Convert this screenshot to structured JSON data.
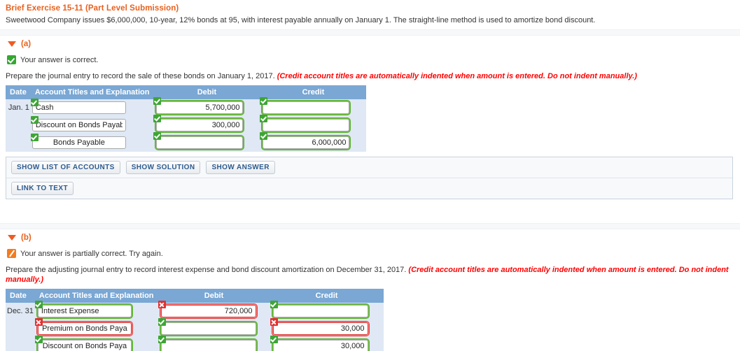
{
  "exercise": {
    "title": "Brief Exercise 15-11 (Part Level Submission)",
    "description": "Sweetwood Company issues $6,000,000, 10-year, 12% bonds at 95, with interest payable annually on January 1. The straight-line method is used to amortize bond discount."
  },
  "columns": {
    "date": "Date",
    "account": "Account Titles and Explanation",
    "debit": "Debit",
    "credit": "Credit"
  },
  "icons": {
    "collapse": "triangle-down-icon",
    "correct": "green-check-icon",
    "partial": "orange-slash-icon",
    "field_ok": "green-check-badge",
    "field_err": "red-x-badge"
  },
  "part_a": {
    "label": "(a)",
    "status": "Your answer is correct.",
    "status_type": "correct",
    "prompt": "Prepare the journal entry to record the sale of these bonds on January 1, 2017.",
    "hint": "(Credit account titles are automatically indented when amount is entered. Do not indent manually.)",
    "rows": [
      {
        "date": "Jan. 1",
        "account": "Cash",
        "account_state": "ok",
        "account_indent": false,
        "debit": "5,700,000",
        "debit_state": "ok",
        "credit": "",
        "credit_state": "ok"
      },
      {
        "date": "",
        "account": "Discount on Bonds Payable",
        "account_state": "ok",
        "account_indent": false,
        "debit": "300,000",
        "debit_state": "ok",
        "credit": "",
        "credit_state": "ok"
      },
      {
        "date": "",
        "account": "Bonds Payable",
        "account_state": "ok",
        "account_indent": true,
        "debit": "",
        "debit_state": "ok",
        "credit": "6,000,000",
        "credit_state": "ok"
      }
    ],
    "buttons_row1": [
      "SHOW LIST OF ACCOUNTS",
      "SHOW SOLUTION",
      "SHOW ANSWER"
    ],
    "buttons_row2": [
      "LINK TO TEXT"
    ]
  },
  "part_b": {
    "label": "(b)",
    "status": "Your answer is partially correct.  Try again.",
    "status_type": "partial",
    "prompt": "Prepare the adjusting journal entry to record interest expense and bond discount amortization on December 31, 2017.",
    "hint": "(Credit account titles are automatically indented when amount is entered. Do not indent manually.)",
    "rows": [
      {
        "date": "Dec. 31",
        "account": "Interest Expense",
        "account_state": "ok",
        "account_indent": false,
        "debit": "720,000",
        "debit_state": "err",
        "credit": "",
        "credit_state": "ok"
      },
      {
        "date": "",
        "account": "Premium on Bonds Paya",
        "account_state": "err",
        "account_indent": true,
        "debit": "",
        "debit_state": "ok",
        "credit": "30,000",
        "credit_state": "err"
      },
      {
        "date": "",
        "account": "Discount on Bonds Paya",
        "account_state": "ok",
        "account_indent": true,
        "debit": "",
        "debit_state": "ok",
        "credit": "30,000",
        "credit_state": "ok"
      }
    ]
  },
  "colors": {
    "accent_orange": "#e8601c",
    "table_header_blue": "#7aa7d4",
    "table_body_blue": "#dfe8f4",
    "hint_red": "#ff0000",
    "ok_green": "#3ea535",
    "err_red": "#e03030",
    "button_text": "#2c5b8f"
  }
}
